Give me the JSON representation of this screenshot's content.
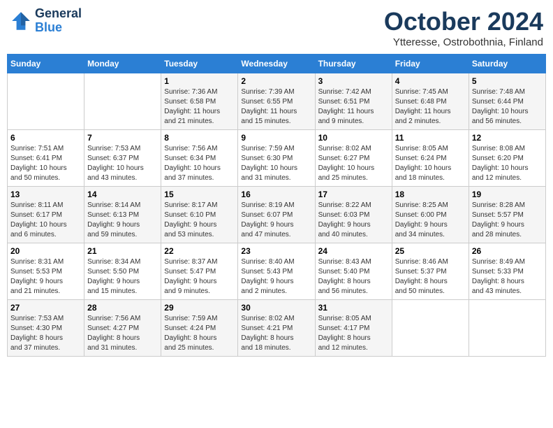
{
  "header": {
    "logo_line1": "General",
    "logo_line2": "Blue",
    "main_title": "October 2024",
    "subtitle": "Ytteresse, Ostrobothnia, Finland"
  },
  "days_of_week": [
    "Sunday",
    "Monday",
    "Tuesday",
    "Wednesday",
    "Thursday",
    "Friday",
    "Saturday"
  ],
  "weeks": [
    [
      {
        "day": "",
        "info": ""
      },
      {
        "day": "",
        "info": ""
      },
      {
        "day": "1",
        "info": "Sunrise: 7:36 AM\nSunset: 6:58 PM\nDaylight: 11 hours\nand 21 minutes."
      },
      {
        "day": "2",
        "info": "Sunrise: 7:39 AM\nSunset: 6:55 PM\nDaylight: 11 hours\nand 15 minutes."
      },
      {
        "day": "3",
        "info": "Sunrise: 7:42 AM\nSunset: 6:51 PM\nDaylight: 11 hours\nand 9 minutes."
      },
      {
        "day": "4",
        "info": "Sunrise: 7:45 AM\nSunset: 6:48 PM\nDaylight: 11 hours\nand 2 minutes."
      },
      {
        "day": "5",
        "info": "Sunrise: 7:48 AM\nSunset: 6:44 PM\nDaylight: 10 hours\nand 56 minutes."
      }
    ],
    [
      {
        "day": "6",
        "info": "Sunrise: 7:51 AM\nSunset: 6:41 PM\nDaylight: 10 hours\nand 50 minutes."
      },
      {
        "day": "7",
        "info": "Sunrise: 7:53 AM\nSunset: 6:37 PM\nDaylight: 10 hours\nand 43 minutes."
      },
      {
        "day": "8",
        "info": "Sunrise: 7:56 AM\nSunset: 6:34 PM\nDaylight: 10 hours\nand 37 minutes."
      },
      {
        "day": "9",
        "info": "Sunrise: 7:59 AM\nSunset: 6:30 PM\nDaylight: 10 hours\nand 31 minutes."
      },
      {
        "day": "10",
        "info": "Sunrise: 8:02 AM\nSunset: 6:27 PM\nDaylight: 10 hours\nand 25 minutes."
      },
      {
        "day": "11",
        "info": "Sunrise: 8:05 AM\nSunset: 6:24 PM\nDaylight: 10 hours\nand 18 minutes."
      },
      {
        "day": "12",
        "info": "Sunrise: 8:08 AM\nSunset: 6:20 PM\nDaylight: 10 hours\nand 12 minutes."
      }
    ],
    [
      {
        "day": "13",
        "info": "Sunrise: 8:11 AM\nSunset: 6:17 PM\nDaylight: 10 hours\nand 6 minutes."
      },
      {
        "day": "14",
        "info": "Sunrise: 8:14 AM\nSunset: 6:13 PM\nDaylight: 9 hours\nand 59 minutes."
      },
      {
        "day": "15",
        "info": "Sunrise: 8:17 AM\nSunset: 6:10 PM\nDaylight: 9 hours\nand 53 minutes."
      },
      {
        "day": "16",
        "info": "Sunrise: 8:19 AM\nSunset: 6:07 PM\nDaylight: 9 hours\nand 47 minutes."
      },
      {
        "day": "17",
        "info": "Sunrise: 8:22 AM\nSunset: 6:03 PM\nDaylight: 9 hours\nand 40 minutes."
      },
      {
        "day": "18",
        "info": "Sunrise: 8:25 AM\nSunset: 6:00 PM\nDaylight: 9 hours\nand 34 minutes."
      },
      {
        "day": "19",
        "info": "Sunrise: 8:28 AM\nSunset: 5:57 PM\nDaylight: 9 hours\nand 28 minutes."
      }
    ],
    [
      {
        "day": "20",
        "info": "Sunrise: 8:31 AM\nSunset: 5:53 PM\nDaylight: 9 hours\nand 21 minutes."
      },
      {
        "day": "21",
        "info": "Sunrise: 8:34 AM\nSunset: 5:50 PM\nDaylight: 9 hours\nand 15 minutes."
      },
      {
        "day": "22",
        "info": "Sunrise: 8:37 AM\nSunset: 5:47 PM\nDaylight: 9 hours\nand 9 minutes."
      },
      {
        "day": "23",
        "info": "Sunrise: 8:40 AM\nSunset: 5:43 PM\nDaylight: 9 hours\nand 2 minutes."
      },
      {
        "day": "24",
        "info": "Sunrise: 8:43 AM\nSunset: 5:40 PM\nDaylight: 8 hours\nand 56 minutes."
      },
      {
        "day": "25",
        "info": "Sunrise: 8:46 AM\nSunset: 5:37 PM\nDaylight: 8 hours\nand 50 minutes."
      },
      {
        "day": "26",
        "info": "Sunrise: 8:49 AM\nSunset: 5:33 PM\nDaylight: 8 hours\nand 43 minutes."
      }
    ],
    [
      {
        "day": "27",
        "info": "Sunrise: 7:53 AM\nSunset: 4:30 PM\nDaylight: 8 hours\nand 37 minutes."
      },
      {
        "day": "28",
        "info": "Sunrise: 7:56 AM\nSunset: 4:27 PM\nDaylight: 8 hours\nand 31 minutes."
      },
      {
        "day": "29",
        "info": "Sunrise: 7:59 AM\nSunset: 4:24 PM\nDaylight: 8 hours\nand 25 minutes."
      },
      {
        "day": "30",
        "info": "Sunrise: 8:02 AM\nSunset: 4:21 PM\nDaylight: 8 hours\nand 18 minutes."
      },
      {
        "day": "31",
        "info": "Sunrise: 8:05 AM\nSunset: 4:17 PM\nDaylight: 8 hours\nand 12 minutes."
      },
      {
        "day": "",
        "info": ""
      },
      {
        "day": "",
        "info": ""
      }
    ]
  ]
}
